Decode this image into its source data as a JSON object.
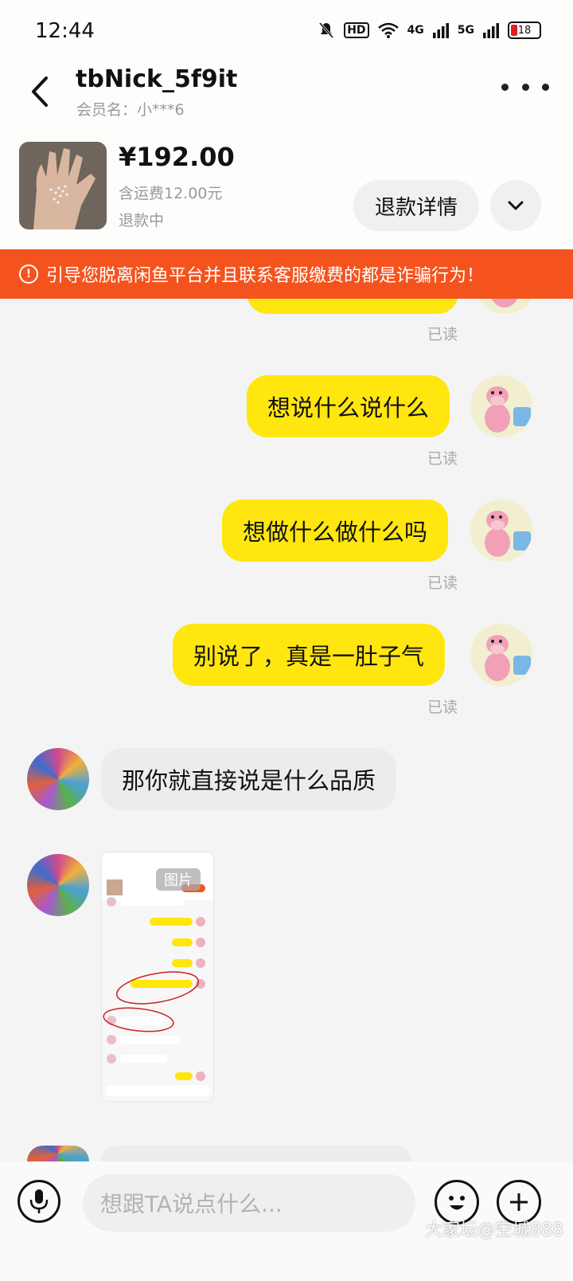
{
  "status_bar": {
    "time": "12:44",
    "network_hd": "HD",
    "network_4g": "4G",
    "network_5g": "5G",
    "battery": "18"
  },
  "header": {
    "title": "tbNick_5f9it",
    "subtitle": "会员名：小***6"
  },
  "order": {
    "price": "¥192.00",
    "shipping": "含运费12.00元",
    "status": "退款中",
    "refund_button": "退款详情"
  },
  "warning": {
    "text": "引导您脱离闲鱼平台并且联系客服缴费的都是诈骗行为！"
  },
  "messages": {
    "read_label": "已读",
    "m1": "想说什么说什么",
    "m2": "想做什么做什么吗",
    "m3": "别说了，真是一肚子气",
    "m4": "那你就直接说是什么品质",
    "image_tag": "图片"
  },
  "input": {
    "placeholder": "想跟TA说点什么..."
  },
  "watermark": "大家坛@空城888",
  "colors": {
    "accent_yellow": "#ffe60f",
    "warning_orange": "#f5531e"
  }
}
